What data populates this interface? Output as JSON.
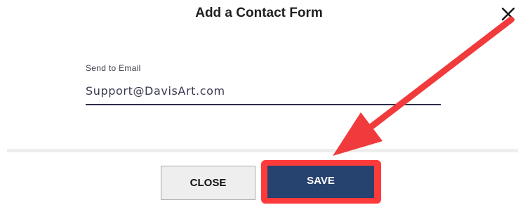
{
  "dialog": {
    "title": "Add a Contact Form",
    "close_icon": "close-icon"
  },
  "field": {
    "label": "Send to Email",
    "value": "Support@DavisArt.com"
  },
  "buttons": {
    "close_label": "CLOSE",
    "save_label": "SAVE"
  },
  "annotation": {
    "icon": "red-arrow-icon",
    "color": "#f03a3c",
    "highlight_color": "#ff3a3a"
  },
  "colors": {
    "save_button": "#26426f",
    "close_button": "#eeeeee",
    "input_underline": "#2c2c4a"
  }
}
